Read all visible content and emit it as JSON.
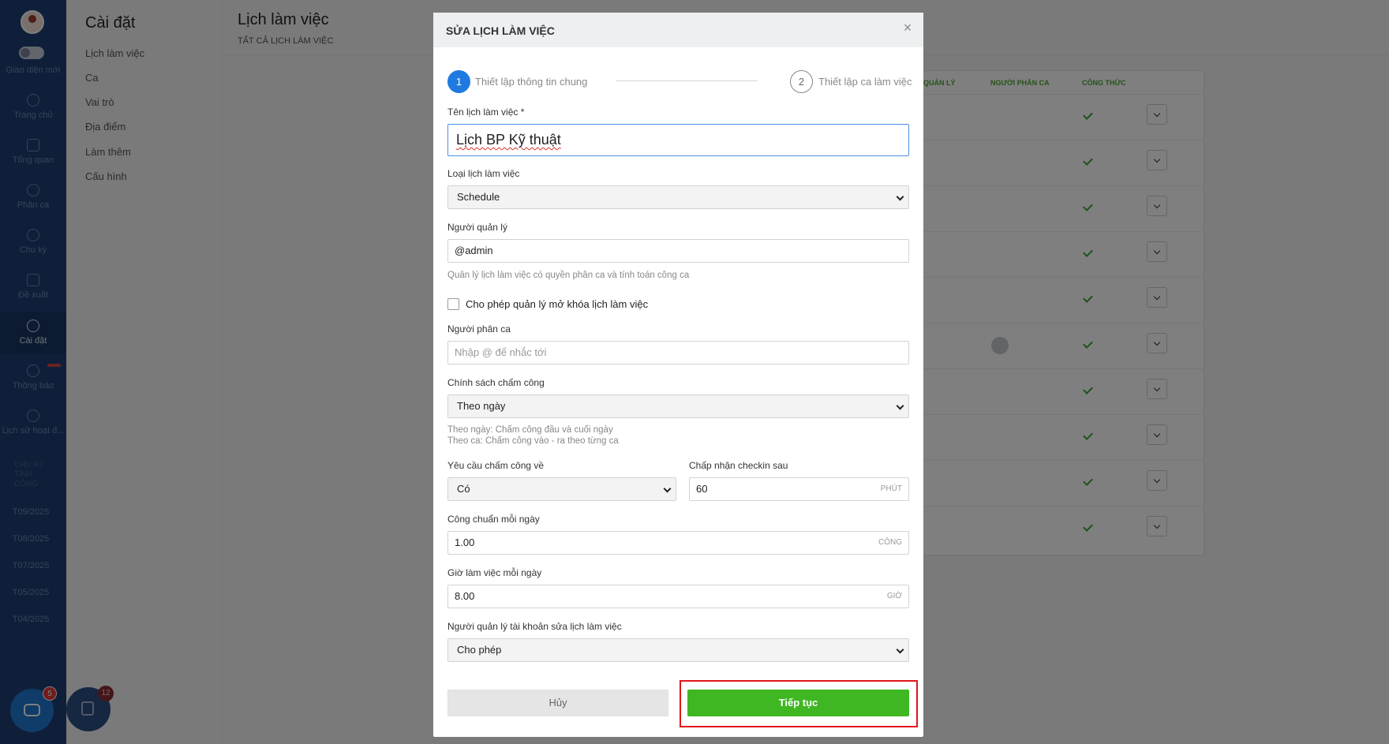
{
  "nav": {
    "mode_label": "Giao diện mới",
    "items": [
      {
        "label": "Trang chủ",
        "icon": "clock-icon"
      },
      {
        "label": "Tổng quan",
        "icon": "grid-icon"
      },
      {
        "label": "Phân ca",
        "icon": "shift-clock-icon"
      },
      {
        "label": "Chu kỳ",
        "icon": "refresh-icon"
      },
      {
        "label": "Đề xuất",
        "icon": "document-icon"
      },
      {
        "label": "Cài đặt",
        "icon": "gear-icon"
      },
      {
        "label": "Thông báo",
        "icon": "bell-icon"
      },
      {
        "label": "Lịch sử hoạt đ...",
        "icon": "history-icon"
      }
    ],
    "cycle_heading": "CHU KỲ TÍNH CÔNG",
    "periods": [
      "T09/2025",
      "T08/2025",
      "T07/2025",
      "T05/2025",
      "T04/2025"
    ]
  },
  "submenu": {
    "title": "Cài đặt",
    "items": [
      "Lịch làm việc",
      "Ca",
      "Vai trò",
      "Địa điểm",
      "Làm thêm",
      "Cấu hình"
    ]
  },
  "main": {
    "title": "Lịch làm việc",
    "subtitle": "TẤT CẢ LỊCH LÀM VIỆC",
    "columns": [
      "QUẢN LÝ",
      "NGƯỜI PHÂN CA",
      "CÔNG THỨC"
    ]
  },
  "floating": {
    "chat_badge": "5",
    "tasks_badge": "12"
  },
  "modal": {
    "title": "SỬA LỊCH LÀM VIỆC",
    "close": "×",
    "steps": [
      {
        "number": "1",
        "label": "Thiết lập thông tin chung"
      },
      {
        "number": "2",
        "label": "Thiết lập ca làm việc"
      }
    ],
    "name_label": "Tên lịch làm việc *",
    "name_value": "Lịch BP Kỹ thuật",
    "type_label": "Loại lịch làm việc",
    "type_value": "Schedule",
    "manager_label": "Người quản lý",
    "manager_value": "@admin",
    "manager_hint": "Quản lý lịch làm việc có quyền phân ca và tính toán công ca",
    "unlock_label": "Cho phép quản lý mở khóa lịch làm việc",
    "assigner_label": "Người phân ca",
    "assigner_placeholder": "Nhập @ để nhắc tới",
    "policy_label": "Chính sách chấm công",
    "policy_value": "Theo ngày",
    "policy_hint_1": "Theo ngày: Chấm công đầu và cuối ngày",
    "policy_hint_2": "Theo ca: Chấm công vào - ra theo từng ca",
    "require_label": "Yêu cầu chấm công về",
    "require_value": "Có",
    "checkin_label": "Chấp nhận checkin sau",
    "checkin_value": "60",
    "checkin_unit": "PHÚT",
    "standard_label": "Công chuẩn mỗi ngày",
    "standard_value": "1.00",
    "standard_unit": "CÔNG",
    "hours_label": "Giờ làm việc mỗi ngày",
    "hours_value": "8.00",
    "hours_unit": "GIỜ",
    "edit_perm_label": "Người quản lý tài khoản sửa lịch làm việc",
    "edit_perm_value": "Cho phép",
    "cancel": "Hủy",
    "next": "Tiếp tục"
  },
  "colors": {
    "nav_bg": "#1e3f74",
    "primary": "#1f7ae0",
    "success": "#3fb723",
    "highlight": "#e0161c"
  }
}
